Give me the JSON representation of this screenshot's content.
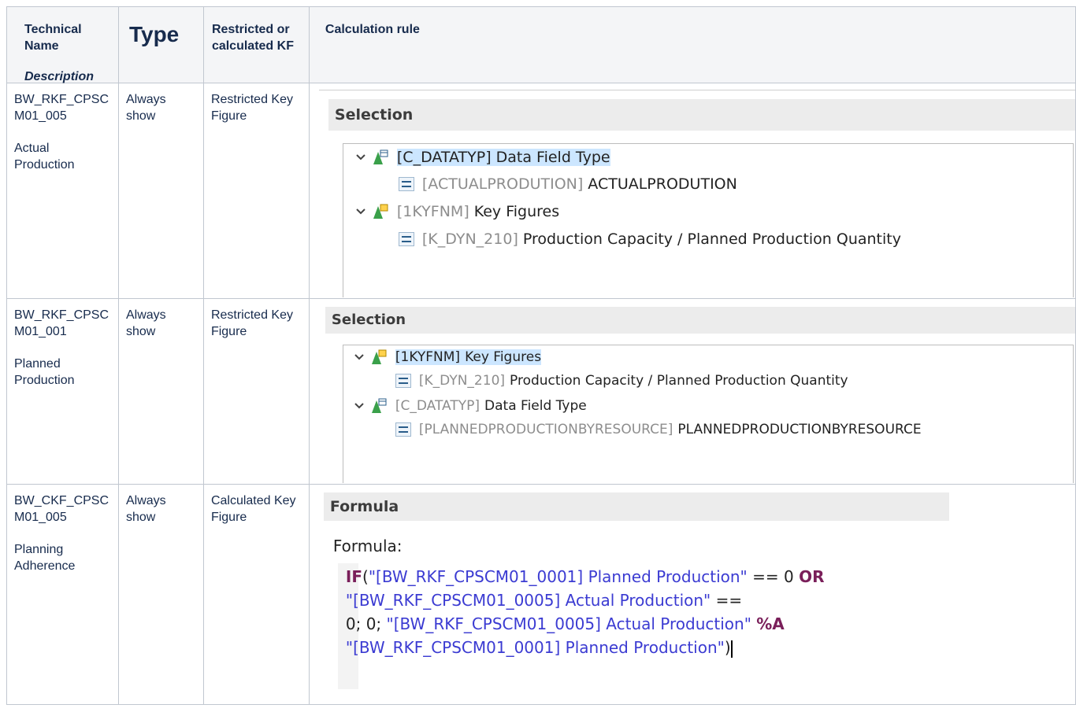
{
  "header": {
    "technical_name": "Technical Name",
    "description": "Description",
    "type": "Type",
    "restricted_or_calculated": "Restricted or calculated KF",
    "calculation_rule": "Calculation rule"
  },
  "rows": [
    {
      "technical_name": "BW_RKF_CPSCM01_005",
      "description": "Actual Production",
      "type": "Always show",
      "kf_type": "Restricted Key Figure",
      "section": "Selection",
      "tree": [
        {
          "key": "[C_DATATYP]",
          "text": "Data Field Type"
        },
        {
          "key": "[ACTUALPRODUTION]",
          "text": "ACTUALPRODUTION"
        },
        {
          "key": "[1KYFNM]",
          "text": "Key Figures"
        },
        {
          "key": "[K_DYN_210]",
          "text": "Production Capacity / Planned Production Quantity"
        }
      ]
    },
    {
      "technical_name": "BW_RKF_CPSCM01_001",
      "description": "Planned Production",
      "type": "Always show",
      "kf_type": "Restricted Key Figure",
      "section": "Selection",
      "tree": [
        {
          "key": "[1KYFNM]",
          "text": "Key Figures"
        },
        {
          "key": "[K_DYN_210]",
          "text": "Production Capacity / Planned Production Quantity"
        },
        {
          "key": "[C_DATATYP]",
          "text": "Data Field Type"
        },
        {
          "key": "[PLANNEDPRODUCTIONBYRESOURCE]",
          "text": "PLANNEDPRODUCTIONBYRESOURCE"
        }
      ]
    },
    {
      "technical_name": "BW_CKF_CPSCM01_005",
      "description": "Planning Adherence",
      "type": "Always show",
      "kf_type": "Calculated Key Figure",
      "section": "Formula",
      "formula_label": "Formula:",
      "formula": {
        "if": "IF",
        "l1": "\"[BW_RKF_CPSCM01_0001] Planned Production\"",
        "op1": " == 0 ",
        "or": "OR",
        "l2": "\"[BW_RKF_CPSCM01_0005] Actual Production\"",
        "op2": " ==",
        "l3a": "0; 0; ",
        "l3b": "\"[BW_RKF_CPSCM01_0005] Actual Production\"",
        "pct": "%A",
        "l4": "\"[BW_RKF_CPSCM01_0001] Planned Production\"",
        "close": ")"
      }
    }
  ],
  "colors": {
    "tree_highlight": "#cce6ff",
    "formula_text": "#3b3bd2",
    "formula_keyword": "#7a1f5a"
  }
}
